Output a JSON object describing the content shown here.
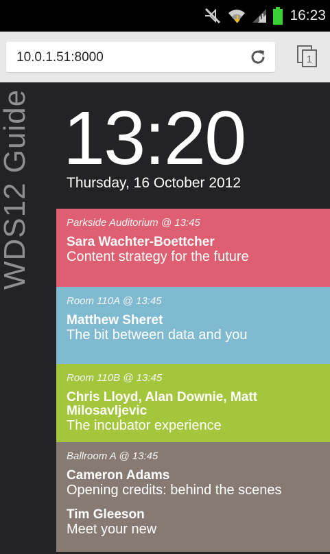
{
  "status_bar": {
    "time": "16:23",
    "icons": [
      "mute-icon",
      "wifi-icon",
      "signal-icon",
      "battery-icon"
    ]
  },
  "browser": {
    "url": "10.0.1.51:8000",
    "tab_count": "1"
  },
  "app": {
    "side_title": "WDS12 Guide",
    "time": "13:20",
    "date": "Thursday, 16 October 2012",
    "sessions": [
      {
        "room": "Parkside Auditorium @ 13:45",
        "speaker": "Sara Wachter-Boettcher",
        "talk": "Content strategy for the future",
        "color": "#dd5f71"
      },
      {
        "room": "Room 110A @ 13:45",
        "speaker": "Matthew Sheret",
        "talk": "The bit between data and you",
        "color": "#7fbad1"
      },
      {
        "room": "Room 110B @ 13:45",
        "speaker": "Chris Lloyd, Alan Downie, Matt Milosavljevic",
        "talk": "The incubator experience",
        "color": "#a3c63c"
      },
      {
        "room": "Ballroom A @ 13:45",
        "speaker": "Cameron Adams",
        "talk": "Opening credits: behind the scenes",
        "speaker2": "Tim Gleeson",
        "talk2": "Meet your new",
        "color": "#877a72"
      }
    ]
  }
}
